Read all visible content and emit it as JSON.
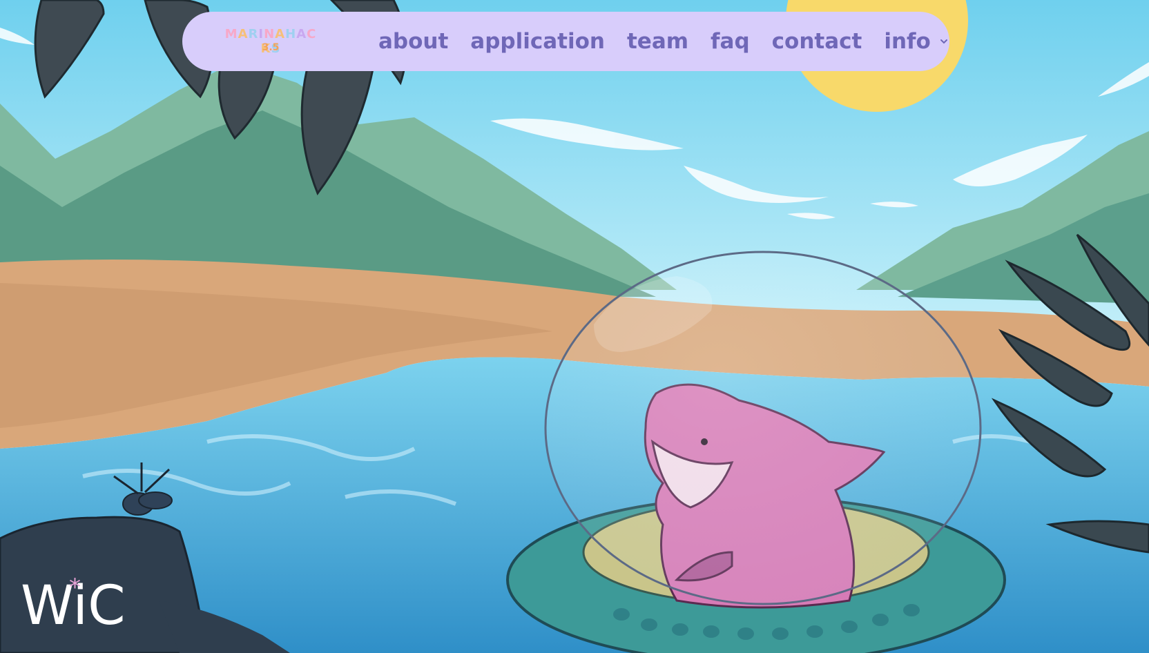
{
  "logo": {
    "line1": "MARINAHACKS",
    "line2": "3.5",
    "letter_colors": [
      "#f7a8c8",
      "#f6c07a",
      "#9fd0f0",
      "#c9a8f0",
      "#f7a8c8",
      "#f6c07a",
      "#9fd0f0",
      "#c9a8f0",
      "#f7a8c8",
      "#f6c07a",
      "#9fd0f0"
    ]
  },
  "nav": {
    "items": [
      {
        "label": "about"
      },
      {
        "label": "application"
      },
      {
        "label": "team"
      },
      {
        "label": "faq"
      },
      {
        "label": "contact"
      },
      {
        "label": "info",
        "icon": "chevron-down-icon"
      }
    ],
    "bg": "#d8cdfb",
    "text_color": "#6f67b7"
  },
  "footer_logo": {
    "text": "WiC"
  },
  "colors": {
    "sky": "#8fd8f0",
    "sand": "#d9a77a",
    "water": "#4fb4de",
    "shark": "#d77bb6",
    "sub": "#3d9a98",
    "sun": "#f8d96a"
  }
}
